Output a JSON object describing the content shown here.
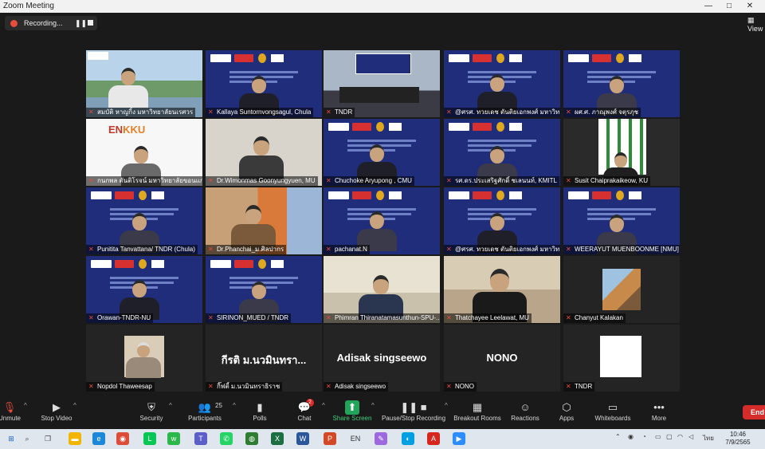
{
  "window": {
    "title": "Zoom Meeting",
    "controls": [
      "—",
      "□",
      "✕"
    ]
  },
  "recording": {
    "label": "Recording...",
    "pause_glyph": "❚❚"
  },
  "view_button": {
    "label": "View"
  },
  "participants": [
    {
      "name": "สมบัติ หาญกิ้ง มหาวิทยาลัยนเรศวร",
      "bg": "campus"
    },
    {
      "name": "Kallaya Suntornvongsagul, Chula",
      "bg": "banner"
    },
    {
      "name": "TNDR",
      "bg": "room",
      "active": true
    },
    {
      "name": "@ศรศ. ทวยเดช ตันติยเอกพงศ์ มหาวิทยาลัยธุรกิจ",
      "bg": "banner"
    },
    {
      "name": "ผศ.ศ. ภาณุพงศ์ จตุรภุช",
      "bg": "banner"
    },
    {
      "name": "กนกพล ตันติโรจน์ มหาวิทยาลัยขอนแก่น",
      "bg": "enkku"
    },
    {
      "name": "Dr.Wimonmas Goonyungyuen, MU",
      "bg": "plain"
    },
    {
      "name": "Chuchoke Aryupong , CMU",
      "bg": "banner"
    },
    {
      "name": "รศ.ดร.ประเสริฐศักดิ์ ชเลนนท์, KMITL",
      "bg": "banner"
    },
    {
      "name": "Susit Chaiprakaikeow, KU",
      "bg": "ku"
    },
    {
      "name": "Punitita Tanvattana/ TNDR (Chula)",
      "bg": "banner"
    },
    {
      "name": "Dr.Phanchai_ม.ศิลปากร",
      "bg": "building"
    },
    {
      "name": "pachanat.N",
      "bg": "banner"
    },
    {
      "name": "@ศรศ. ทวยเดช ตันติยเอกพงศ์ มหาวิทยาลัยธุรกิจ",
      "bg": "banner"
    },
    {
      "name": "WEERAYUT MUENBOONME [NMU]",
      "bg": "banner"
    },
    {
      "name": "Orawan-TNDR-NU",
      "bg": "banner"
    },
    {
      "name": "SIRINON_MUED / TNDR",
      "bg": "banner"
    },
    {
      "name": "Phimran Thiranatamasunthun-SPU-...",
      "bg": "office"
    },
    {
      "name": "Thatchayee Leelawat, MU",
      "bg": "office2"
    },
    {
      "name": "Chanyut Kalakan",
      "bg": "photo"
    },
    {
      "name": "Nopdol Thaweesap",
      "bg": "photo2"
    },
    {
      "name": "กิ๊ฟตี้ ม.นวมินทราธิราช",
      "bg": "text",
      "big": "กีรติ ม.นวมินทรา..."
    },
    {
      "name": "Adisak singseewo",
      "bg": "text",
      "big": "Adisak singseewo"
    },
    {
      "name": "NONO",
      "bg": "text",
      "big": "NONO"
    },
    {
      "name": "TNDR",
      "bg": "white"
    }
  ],
  "toolbar": {
    "items": [
      {
        "key": "unmute",
        "label": "Unmute",
        "icon": "mic-muted-icon",
        "glyph": "🎙"
      },
      {
        "key": "video",
        "label": "Stop Video",
        "icon": "video-camera-icon",
        "glyph": "▶"
      },
      {
        "key": "security",
        "label": "Security",
        "icon": "shield-icon",
        "glyph": "⛨"
      },
      {
        "key": "participants",
        "label": "Participants",
        "icon": "people-icon",
        "glyph": "👥"
      },
      {
        "key": "polls",
        "label": "Polls",
        "icon": "bar-chart-icon",
        "glyph": "▮"
      },
      {
        "key": "chat",
        "label": "Chat",
        "icon": "chat-bubble-icon",
        "glyph": "💬"
      },
      {
        "key": "share",
        "label": "Share Screen",
        "icon": "share-arrow-icon",
        "glyph": "⬆"
      },
      {
        "key": "recording",
        "label": "Pause/Stop Recording",
        "icon": "pause-stop-icon",
        "glyph": "❚❚ ■"
      },
      {
        "key": "breakout",
        "label": "Breakout Rooms",
        "icon": "grid-icon",
        "glyph": "▦"
      },
      {
        "key": "reactions",
        "label": "Reactions",
        "icon": "smiley-plus-icon",
        "glyph": "☺"
      },
      {
        "key": "apps",
        "label": "Apps",
        "icon": "apps-icon",
        "glyph": "⬡"
      },
      {
        "key": "whiteboards",
        "label": "Whiteboards",
        "icon": "whiteboard-icon",
        "glyph": "▭"
      },
      {
        "key": "more",
        "label": "More",
        "icon": "ellipsis-icon",
        "glyph": "•••"
      }
    ],
    "participants_count": "25",
    "chat_badge": "2",
    "end_label": "End"
  },
  "taskbar": {
    "icons": [
      {
        "name": "windows-start-icon",
        "glyph": "⊞",
        "color": "#1565c0"
      },
      {
        "name": "search-icon",
        "glyph": "⌕",
        "color": "#444"
      },
      {
        "name": "task-view-icon",
        "glyph": "❐",
        "color": "#444"
      },
      {
        "name": "file-explorer-icon",
        "glyph": "▬",
        "color": "#f2b600"
      },
      {
        "name": "edge-browser-icon",
        "glyph": "e",
        "color": "#1a87d8"
      },
      {
        "name": "chrome-browser-icon",
        "glyph": "◉",
        "color": "#dd4b39"
      },
      {
        "name": "line-app-icon",
        "glyph": "L",
        "color": "#06c755"
      },
      {
        "name": "wechat-icon",
        "glyph": "w",
        "color": "#2ab84a"
      },
      {
        "name": "teams-icon",
        "glyph": "T",
        "color": "#5b5fc7"
      },
      {
        "name": "whatsapp-icon",
        "glyph": "✆",
        "color": "#25d366"
      },
      {
        "name": "globe-app-icon",
        "glyph": "◍",
        "color": "#2e7d32"
      },
      {
        "name": "excel-icon",
        "glyph": "X",
        "color": "#1d6f42"
      },
      {
        "name": "word-icon",
        "glyph": "W",
        "color": "#2b579a"
      },
      {
        "name": "powerpoint-icon",
        "glyph": "P",
        "color": "#d24726"
      },
      {
        "name": "language-icon",
        "glyph": "EN",
        "color": "#333"
      },
      {
        "name": "paint-icon",
        "glyph": "✎",
        "color": "#9c6ade"
      },
      {
        "name": "globe-icon",
        "glyph": "◐",
        "color": "#00a0e3"
      },
      {
        "name": "acrobat-icon",
        "glyph": "A",
        "color": "#d7261e"
      },
      {
        "name": "zoom-app-icon",
        "glyph": "▶",
        "color": "#2d8cff"
      }
    ],
    "tray_lang": "ไทย",
    "time": "10:46",
    "date": "7/9/2565"
  }
}
